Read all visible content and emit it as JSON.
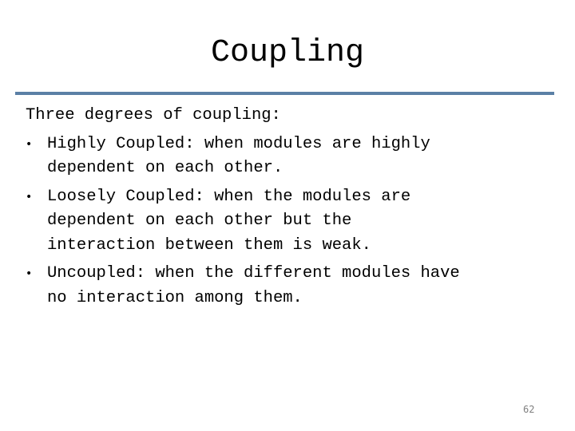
{
  "slide": {
    "title": "Coupling",
    "intro": "Three degrees of coupling:",
    "bullets": [
      {
        "lines": [
          "Highly Coupled: when modules are highly",
          "dependent on each other."
        ]
      },
      {
        "lines": [
          "Loosely Coupled: when the modules are",
          "dependent on each other but the",
          "interaction between them is weak."
        ]
      },
      {
        "lines": [
          "Uncoupled: when the different modules have",
          "no interaction among them."
        ]
      }
    ],
    "bullet_glyph": "•",
    "page_number": "62",
    "accent_color": "#5b80a5"
  }
}
